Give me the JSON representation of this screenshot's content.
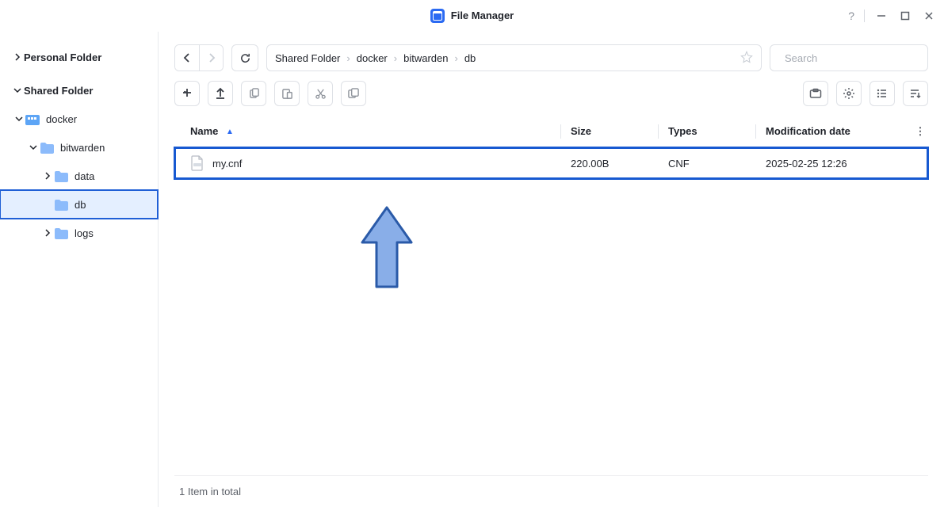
{
  "window": {
    "title": "File Manager"
  },
  "sidebar": {
    "personal_label": "Personal Folder",
    "shared_label": "Shared Folder",
    "tree": {
      "docker": {
        "label": "docker"
      },
      "bitwarden": {
        "label": "bitwarden"
      },
      "data": {
        "label": "data"
      },
      "db": {
        "label": "db"
      },
      "logs": {
        "label": "logs"
      }
    }
  },
  "breadcrumb": {
    "items": [
      "Shared Folder",
      "docker",
      "bitwarden",
      "db"
    ]
  },
  "search": {
    "placeholder": "Search"
  },
  "columns": {
    "name": "Name",
    "size": "Size",
    "types": "Types",
    "date": "Modification date"
  },
  "rows": [
    {
      "name": "my.cnf",
      "size": "220.00B",
      "type": "CNF",
      "date": "2025-02-25 12:26"
    }
  ],
  "status": {
    "total": "1 Item in total"
  }
}
